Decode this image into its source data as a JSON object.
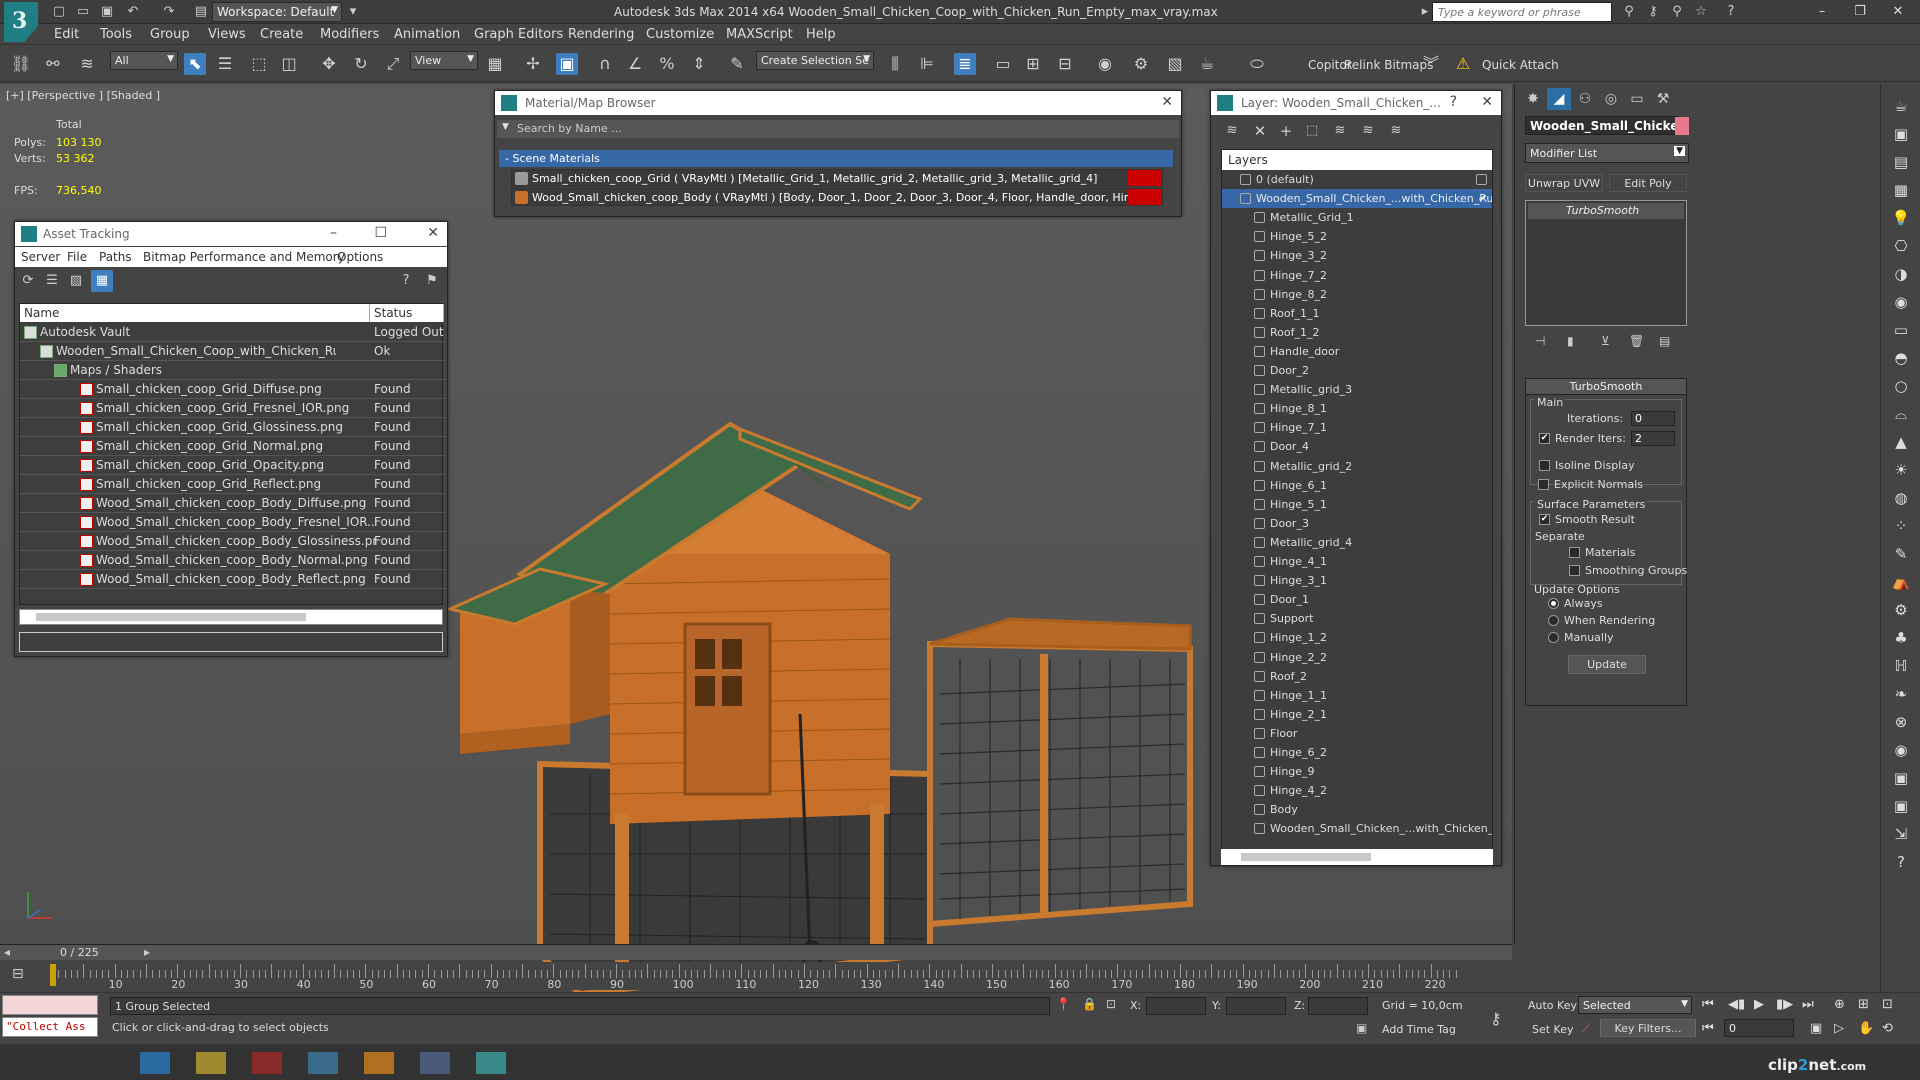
{
  "titlebar": {
    "workspace": "Workspace: Default",
    "app_title": "Autodesk 3ds Max  2014 x64     Wooden_Small_Chicken_Coop_with_Chicken_Run_Empty_max_vray.max",
    "search_placeholder": "Type a keyword or phrase"
  },
  "menu": [
    "Edit",
    "Tools",
    "Group",
    "Views",
    "Create",
    "Modifiers",
    "Animation",
    "Graph Editors",
    "Rendering",
    "Customize",
    "MAXScript",
    "Help"
  ],
  "toolbar": {
    "filter": "All",
    "ref_coord": "View",
    "selection_set": "Create Selection Se",
    "copitor": "Copitor",
    "relink": "Relink Bitmaps",
    "quick_attach": "Quick Attach"
  },
  "viewport": {
    "label": "[+] [Perspective ] [Shaded ]",
    "total_label": "Total",
    "polys_label": "Polys:",
    "polys": "103 130",
    "verts_label": "Verts:",
    "verts": "53 362",
    "fps_label": "FPS:",
    "fps": "736,540"
  },
  "material_browser": {
    "title": "Material/Map Browser",
    "search": "Search by Name ...",
    "group": "- Scene Materials",
    "items": [
      "Small_chicken_coop_Grid  ( VRayMtl ) [Metallic_Grid_1, Metallic_grid_2, Metallic_grid_3, Metallic_grid_4]",
      "Wood_Small_chicken_coop_Body  ( VRayMtl ) [Body, Door_1, Door_2, Door_3, Door_4, Floor, Handle_door, Hinge_1_1, Hi..."
    ]
  },
  "asset_tracking": {
    "title": "Asset Tracking",
    "menu": [
      "Server",
      "File",
      "Paths",
      "Bitmap Performance and Memory",
      "Options"
    ],
    "col_name": "Name",
    "col_status": "Status",
    "rows": [
      {
        "name": "Autodesk Vault",
        "status": "Logged Out"
      },
      {
        "name": "Wooden_Small_Chicken_Coop_with_Chicken_Run_E...",
        "status": "Ok"
      },
      {
        "name": "Maps / Shaders",
        "status": ""
      },
      {
        "name": "Small_chicken_coop_Grid_Diffuse.png",
        "status": "Found"
      },
      {
        "name": "Small_chicken_coop_Grid_Fresnel_IOR.png",
        "status": "Found"
      },
      {
        "name": "Small_chicken_coop_Grid_Glossiness.png",
        "status": "Found"
      },
      {
        "name": "Small_chicken_coop_Grid_Normal.png",
        "status": "Found"
      },
      {
        "name": "Small_chicken_coop_Grid_Opacity.png",
        "status": "Found"
      },
      {
        "name": "Small_chicken_coop_Grid_Reflect.png",
        "status": "Found"
      },
      {
        "name": "Wood_Small_chicken_coop_Body_Diffuse.png",
        "status": "Found"
      },
      {
        "name": "Wood_Small_chicken_coop_Body_Fresnel_IOR....",
        "status": "Found"
      },
      {
        "name": "Wood_Small_chicken_coop_Body_Glossiness.png",
        "status": "Found"
      },
      {
        "name": "Wood_Small_chicken_coop_Body_Normal.png",
        "status": "Found"
      },
      {
        "name": "Wood_Small_chicken_coop_Body_Reflect.png",
        "status": "Found"
      }
    ]
  },
  "layers": {
    "title": "Layer: Wooden_Small_Chicken_...",
    "header": "Layers",
    "items": [
      "0 (default)",
      "Wooden_Small_Chicken_...with_Chicken_Run_",
      "Metallic_Grid_1",
      "Hinge_5_2",
      "Hinge_3_2",
      "Hinge_7_2",
      "Hinge_8_2",
      "Roof_1_1",
      "Roof_1_2",
      "Handle_door",
      "Door_2",
      "Metallic_grid_3",
      "Hinge_8_1",
      "Hinge_7_1",
      "Door_4",
      "Metallic_grid_2",
      "Hinge_6_1",
      "Hinge_5_1",
      "Door_3",
      "Metallic_grid_4",
      "Hinge_4_1",
      "Hinge_3_1",
      "Door_1",
      "Support",
      "Hinge_1_2",
      "Hinge_2_2",
      "Roof_2",
      "Hinge_1_1",
      "Hinge_2_1",
      "Floor",
      "Hinge_6_2",
      "Hinge_9",
      "Hinge_4_2",
      "Body",
      "Wooden_Small_Chicken_...with_Chicken_Ru"
    ]
  },
  "command_panel": {
    "object_name": "Wooden_Small_Chicken_",
    "modifier_list": "Modifier List",
    "btn_unwrap": "Unwrap UVW",
    "btn_editpoly": "Edit Poly",
    "stack_item": "TurboSmooth",
    "rollout_title": "TurboSmooth",
    "main": "Main",
    "iterations_label": "Iterations:",
    "iterations": "0",
    "render_iters_label": "Render Iters:",
    "render_iters": "2",
    "isoline": "Isoline Display",
    "explicit": "Explicit Normals",
    "surface": "Surface Parameters",
    "smooth_result": "Smooth Result",
    "separate": "Separate",
    "materials": "Materials",
    "smoothing_groups": "Smoothing Groups",
    "update_options": "Update Options",
    "always": "Always",
    "when_rendering": "When Rendering",
    "manually": "Manually",
    "update": "Update"
  },
  "timeline": {
    "frame": "0 / 225",
    "ticks": [
      "10",
      "20",
      "30",
      "40",
      "50",
      "60",
      "70",
      "80",
      "90",
      "100",
      "110",
      "120",
      "130",
      "140",
      "150",
      "160",
      "170",
      "180",
      "190",
      "200",
      "210",
      "220"
    ]
  },
  "status": {
    "maxscript": "\"Collect Ass",
    "selected": "1 Group Selected",
    "prompt": "Click or click-and-drag to select objects",
    "x_label": "X:",
    "y_label": "Y:",
    "z_label": "Z:",
    "grid": "Grid = 10,0cm",
    "add_time_tag": "Add Time Tag",
    "auto_key": "Auto Key",
    "set_key": "Set Key",
    "selected_ddl": "Selected",
    "key_filters": "Key Filters...",
    "frame_value": "0"
  },
  "watermark_a": "clip",
  "watermark_b": "2",
  "watermark_c": "net",
  "watermark_d": ".com",
  "colors": {
    "accent": "#3668a8",
    "wood": "#c8702a",
    "roof": "#3f6b46"
  }
}
